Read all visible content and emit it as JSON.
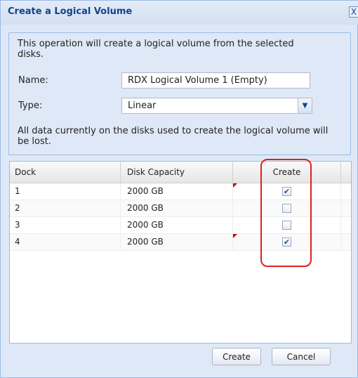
{
  "dialog": {
    "title": "Create a Logical Volume",
    "close_symbol": "X"
  },
  "form": {
    "intro": "This operation will create a logical volume from the selected disks.",
    "name_label": "Name:",
    "name_value": "RDX Logical Volume 1 (Empty)",
    "type_label": "Type:",
    "type_value": "Linear",
    "warning": "All data currently on the disks used to create the logical volume will be lost."
  },
  "grid": {
    "headers": {
      "dock": "Dock",
      "capacity": "Disk Capacity",
      "create": "Create"
    },
    "rows": [
      {
        "dock": "1",
        "capacity": "2000 GB",
        "create": true
      },
      {
        "dock": "2",
        "capacity": "2000 GB",
        "create": false
      },
      {
        "dock": "3",
        "capacity": "2000 GB",
        "create": false
      },
      {
        "dock": "4",
        "capacity": "2000 GB",
        "create": true
      }
    ]
  },
  "buttons": {
    "create": "Create",
    "cancel": "Cancel"
  }
}
